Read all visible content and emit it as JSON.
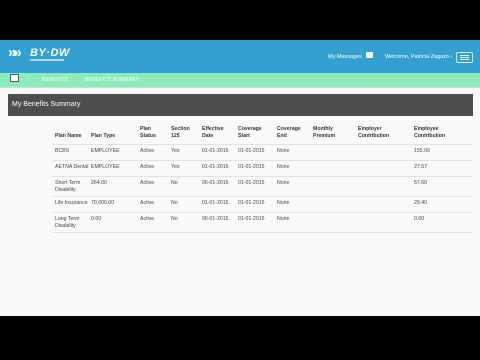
{
  "header": {
    "logo_text": "BY·DW",
    "messages_label": "My Messages",
    "welcome": "Welcome, Patricia Zagazo ‹"
  },
  "breadcrumb": {
    "items": [
      "BENEFITS",
      "BENEFITS SUMMARY"
    ]
  },
  "panel": {
    "title": "My Benefits Summary"
  },
  "table": {
    "headers": [
      [
        "Plan Name"
      ],
      [
        "Plan Type"
      ],
      [
        "Plan",
        "Status"
      ],
      [
        "Section",
        "125"
      ],
      [
        "Effective",
        "Date"
      ],
      [
        "Coverage",
        "Start"
      ],
      [
        "Coverage",
        "End"
      ],
      [
        "Monthly",
        "Premium"
      ],
      [
        "Employer",
        "Contribution"
      ],
      [
        "Employee",
        "Contribution"
      ]
    ],
    "rows": [
      [
        [
          "BCBS"
        ],
        [
          "EMPLOYEE"
        ],
        [
          "Active"
        ],
        [
          "Yes"
        ],
        [
          "01-01-2015"
        ],
        [
          "01-01-2015"
        ],
        [
          "None"
        ],
        [
          ""
        ],
        [
          ""
        ],
        [
          "155.00"
        ]
      ],
      [
        [
          "AETNA Dental"
        ],
        [
          "EMPLOYEE"
        ],
        [
          "Active"
        ],
        [
          "Yes"
        ],
        [
          "01-01-2015"
        ],
        [
          "01-01-2015"
        ],
        [
          "None"
        ],
        [
          ""
        ],
        [
          ""
        ],
        [
          "27.57"
        ]
      ],
      [
        [
          "Short Term",
          "Disability"
        ],
        [
          "264.00"
        ],
        [
          "Active"
        ],
        [
          "No"
        ],
        [
          "06-01-2015"
        ],
        [
          "01-01-2015"
        ],
        [
          "None"
        ],
        [
          ""
        ],
        [
          ""
        ],
        [
          "57.60"
        ]
      ],
      [
        [
          "Life Insurance"
        ],
        [
          "70,000.00"
        ],
        [
          "Active"
        ],
        [
          "No"
        ],
        [
          "01-01-2015"
        ],
        [
          "01-01-2015"
        ],
        [
          "None"
        ],
        [
          ""
        ],
        [
          ""
        ],
        [
          "29.40"
        ]
      ],
      [
        [
          "Long Term",
          "Disability"
        ],
        [
          "0.00"
        ],
        [
          "Active"
        ],
        [
          "No"
        ],
        [
          "06-01-2015"
        ],
        [
          "01-01-2015"
        ],
        [
          "None"
        ],
        [
          ""
        ],
        [
          ""
        ],
        [
          "0.00"
        ]
      ]
    ]
  },
  "colors": {
    "header_bg": "#34a0cf",
    "breadcrumb_bg": "#8eeab7",
    "panel_head_bg": "#4e4e4e",
    "app_bg": "#fafafa"
  },
  "icons": [
    "logo-chevrons-icon",
    "envelope-icon",
    "hamburger-menu-icon",
    "home-icon"
  ]
}
